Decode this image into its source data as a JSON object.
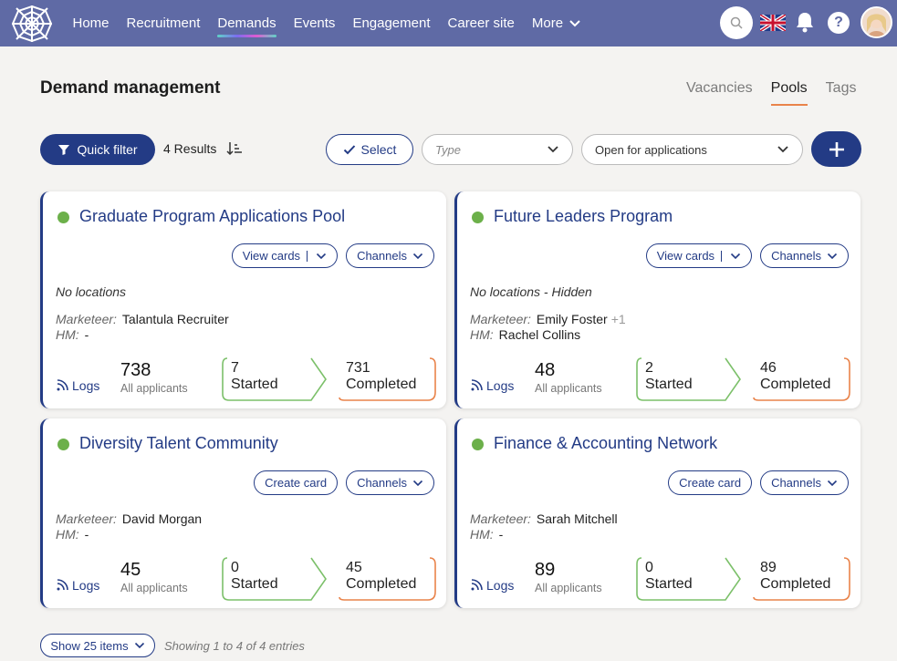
{
  "nav": {
    "links": [
      {
        "label": "Home"
      },
      {
        "label": "Recruitment"
      },
      {
        "label": "Demands"
      },
      {
        "label": "Events"
      },
      {
        "label": "Engagement"
      },
      {
        "label": "Career site"
      },
      {
        "label": "More"
      }
    ],
    "active": "Demands",
    "icons": [
      "spider-web-logo",
      "search-icon",
      "uk-flag-icon",
      "bell-icon",
      "help-icon",
      "avatar"
    ]
  },
  "header": {
    "title": "Demand management",
    "tabs": [
      {
        "label": "Vacancies"
      },
      {
        "label": "Pools"
      },
      {
        "label": "Tags"
      }
    ],
    "active_tab": "Pools"
  },
  "toolbar": {
    "quick_filter": "Quick filter",
    "results": "4 Results",
    "select": "Select",
    "type_placeholder": "Type",
    "status_value": "Open for applications"
  },
  "cards": [
    {
      "title": "Graduate Program Applications Pool",
      "buttons": [
        "View cards",
        "Channels"
      ],
      "locations": "No locations",
      "marketeer_label": "Marketeer:",
      "marketeer": "Talantula Recruiter",
      "marketeer_extra": "",
      "hm_label": "HM:",
      "hm": "-",
      "logs": "Logs",
      "all_applicants": "738",
      "all_applicants_label": "All applicants",
      "started": "7",
      "started_label": "Started",
      "completed": "731",
      "completed_label": "Completed"
    },
    {
      "title": "Future Leaders Program",
      "buttons": [
        "View cards",
        "Channels"
      ],
      "locations": "No locations - Hidden",
      "marketeer_label": "Marketeer:",
      "marketeer": "Emily Foster",
      "marketeer_extra": "+1",
      "hm_label": "HM:",
      "hm": "Rachel Collins",
      "logs": "Logs",
      "all_applicants": "48",
      "all_applicants_label": "All applicants",
      "started": "2",
      "started_label": "Started",
      "completed": "46",
      "completed_label": "Completed"
    },
    {
      "title": "Diversity Talent Community",
      "buttons": [
        "Create card",
        "Channels"
      ],
      "locations": "",
      "marketeer_label": "Marketeer:",
      "marketeer": "David Morgan",
      "marketeer_extra": "",
      "hm_label": "HM:",
      "hm": "-",
      "logs": "Logs",
      "all_applicants": "45",
      "all_applicants_label": "All applicants",
      "started": "0",
      "started_label": "Started",
      "completed": "45",
      "completed_label": "Completed"
    },
    {
      "title": "Finance & Accounting Network",
      "buttons": [
        "Create card",
        "Channels"
      ],
      "locations": "",
      "marketeer_label": "Marketeer:",
      "marketeer": "Sarah Mitchell",
      "marketeer_extra": "",
      "hm_label": "HM:",
      "hm": "-",
      "logs": "Logs",
      "all_applicants": "89",
      "all_applicants_label": "All applicants",
      "started": "0",
      "started_label": "Started",
      "completed": "89",
      "completed_label": "Completed"
    }
  ],
  "footer": {
    "show_items": "Show 25 items",
    "showing": "Showing 1 to 4 of 4 entries"
  },
  "colors": {
    "nav_bg": "#5f6aa5",
    "primary": "#233b85",
    "status_green": "#6cb04a",
    "started_green": "#7cc06a",
    "completed_orange": "#e9834a"
  }
}
